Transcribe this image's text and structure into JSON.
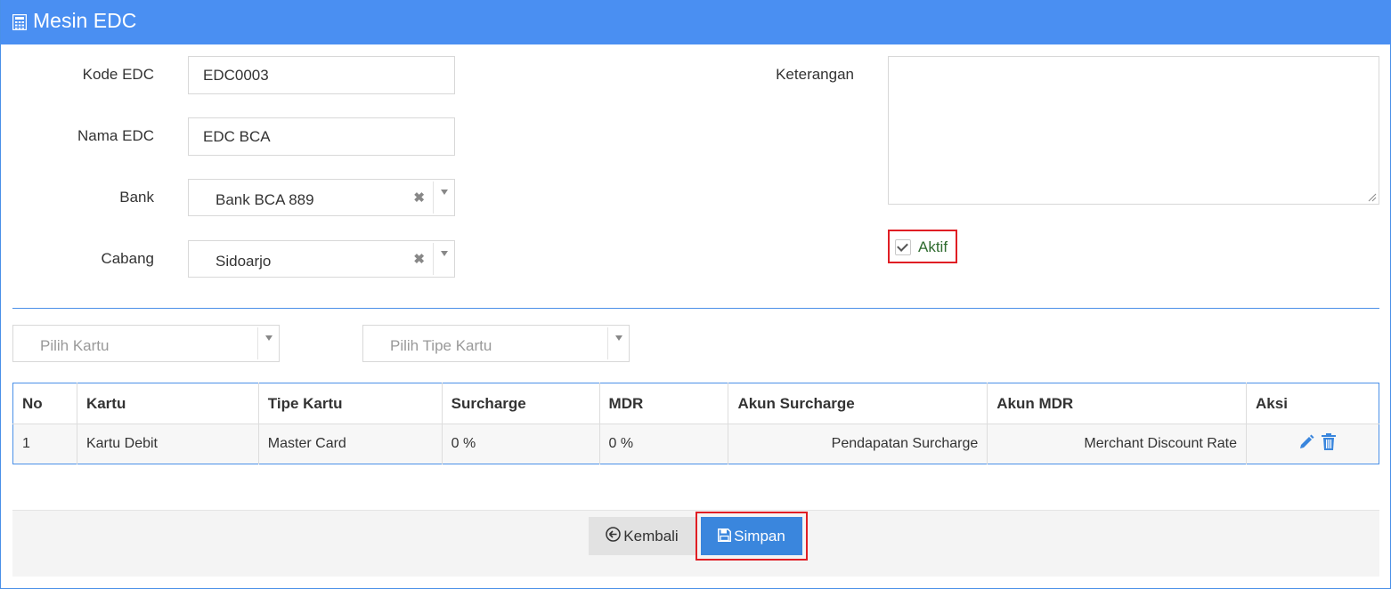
{
  "header": {
    "title": "Mesin EDC",
    "icon": "calculator-icon"
  },
  "form": {
    "kode_label": "Kode EDC",
    "kode_value": "EDC0003",
    "nama_label": "Nama EDC",
    "nama_value": "EDC BCA",
    "bank_label": "Bank",
    "bank_value": "Bank BCA 889",
    "cabang_label": "Cabang",
    "cabang_value": "Sidoarjo",
    "keterangan_label": "Keterangan",
    "keterangan_value": "",
    "aktif_label": "Aktif",
    "aktif_checked": true
  },
  "filters": {
    "kartu_placeholder": "Pilih Kartu",
    "tipe_placeholder": "Pilih Tipe Kartu"
  },
  "table": {
    "columns": [
      "No",
      "Kartu",
      "Tipe Kartu",
      "Surcharge",
      "MDR",
      "Akun Surcharge",
      "Akun MDR",
      "Aksi"
    ],
    "rows": [
      {
        "no": "1",
        "kartu": "Kartu Debit",
        "tipe": "Master Card",
        "surcharge": "0 %",
        "mdr": "0 %",
        "akun_surcharge": "Pendapatan Surcharge",
        "akun_mdr": "Merchant Discount Rate"
      }
    ]
  },
  "footer": {
    "back_label": "Kembali",
    "save_label": "Simpan"
  },
  "colors": {
    "header": "#4a8ff2",
    "primary": "#3a86dd",
    "highlight": "#e01e24",
    "aktif": "#2f6b2f"
  }
}
